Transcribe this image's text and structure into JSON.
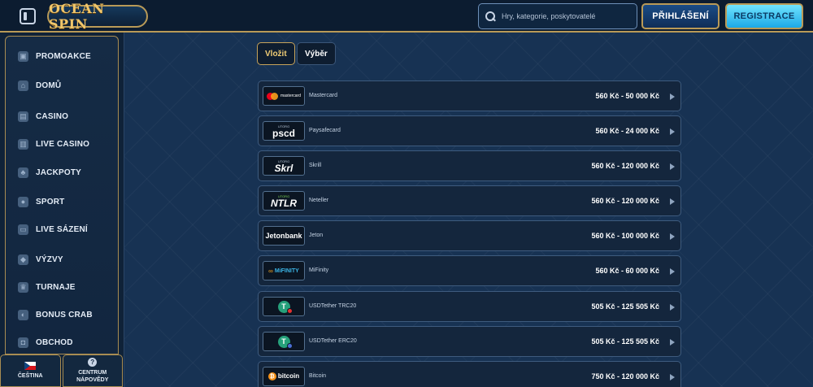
{
  "header": {
    "logo_text": "OCEAN SPIN",
    "search_placeholder": "Hry, kategorie, poskytovatelé",
    "login_label": "PŘIHLÁŠENÍ",
    "register_label": "REGISTRACE"
  },
  "sidebar": {
    "items": [
      {
        "label": "PROMOAKCE",
        "icon": "gift-icon"
      },
      {
        "label": "DOMŮ",
        "icon": "home-icon"
      },
      {
        "label": "CASINO",
        "icon": "casino-icon"
      },
      {
        "label": "LIVE CASINO",
        "icon": "live-casino-icon"
      },
      {
        "label": "JACKPOTY",
        "icon": "clover-icon"
      },
      {
        "label": "SPORT",
        "icon": "ball-icon"
      },
      {
        "label": "LIVE SÁZENÍ",
        "icon": "live-betting-icon"
      },
      {
        "label": "VÝZVY",
        "icon": "shield-icon"
      },
      {
        "label": "TURNAJE",
        "icon": "trophy-icon"
      },
      {
        "label": "BONUS CRAB",
        "icon": "crab-icon"
      },
      {
        "label": "OBCHOD",
        "icon": "shop-icon"
      }
    ],
    "bottom": {
      "language_label": "ČEŠTINA",
      "help_label_line1": "CENTRUM",
      "help_label_line2": "NÁPOVĚDY"
    }
  },
  "tabs": {
    "deposit_label": "Vložit",
    "withdraw_label": "Výběr",
    "active": "deposit"
  },
  "methods": [
    {
      "name": "Mastercard",
      "range": "560 Kč - 50 000 Kč",
      "logo": "mastercard",
      "logo_text": "mastercard"
    },
    {
      "name": "Paysafecard",
      "range": "560 Kč - 24 000 Kč",
      "logo": "paysafecard",
      "logo_text": "pscd",
      "logo_small": "UTORG"
    },
    {
      "name": "Skrill",
      "range": "560 Kč - 120 000 Kč",
      "logo": "skrill",
      "logo_text": "Skrl",
      "logo_small": "UTORG"
    },
    {
      "name": "Neteller",
      "range": "560 Kč - 120 000 Kč",
      "logo": "neteller",
      "logo_text": "NTLR",
      "logo_small": "UTORG"
    },
    {
      "name": "Jeton",
      "range": "560 Kč - 100 000 Kč",
      "logo": "jeton",
      "logo_text": "Jetonbank"
    },
    {
      "name": "MiFinity",
      "range": "560 Kč - 60 000 Kč",
      "logo": "mifinity",
      "logo_text": "MiFINITY"
    },
    {
      "name": "USDTether TRC20",
      "range": "505 Kč - 125 505 Kč",
      "logo": "usdt-trc20",
      "logo_text": "T"
    },
    {
      "name": "USDTether ERC20",
      "range": "505 Kč - 125 505 Kč",
      "logo": "usdt-erc20",
      "logo_text": "T"
    },
    {
      "name": "Bitcoin",
      "range": "750 Kč - 120 000 Kč",
      "logo": "bitcoin",
      "logo_text": "bitcoin"
    }
  ],
  "colors": {
    "accent_gold": "#c7a35a",
    "register_blue": "#1da9e6",
    "background": "#173253"
  }
}
